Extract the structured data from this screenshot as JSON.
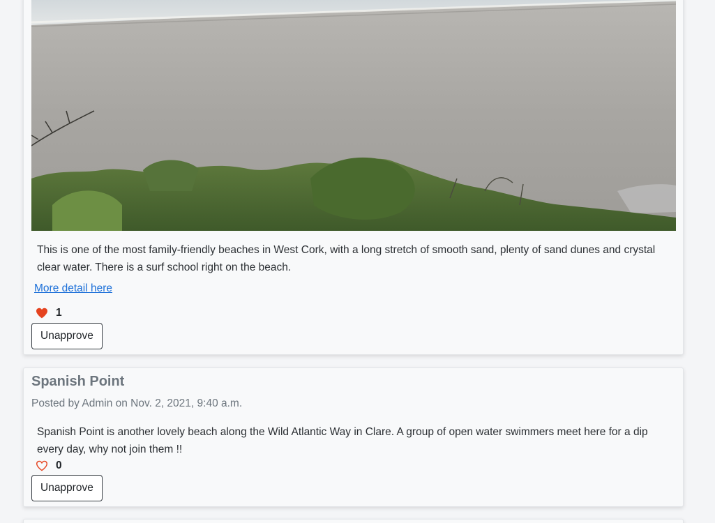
{
  "posts": [
    {
      "image_alt": "Beach photo: sand and grassy dunes",
      "body": "This is one of the most family-friendly beaches in West Cork, with a long stretch of smooth sand, plenty of sand dunes and crystal clear water. There is a surf school right on the beach.",
      "detail_link": "More detail here",
      "likes": "1",
      "liked": true,
      "action_button": "Unapprove"
    },
    {
      "title": "Spanish Point",
      "meta": "Posted by Admin on Nov. 2, 2021, 9:40 a.m.",
      "body": "Spanish Point is another lovely beach along the Wild Atlantic Way in Clare. A group of open water swimmers meet here for a dip every day, why not join them !!",
      "likes": "0",
      "liked": false,
      "action_button": "Unapprove"
    }
  ],
  "colors": {
    "heart": "#e5431f",
    "link": "#1b6fd8",
    "muted_text": "#6c757d"
  }
}
